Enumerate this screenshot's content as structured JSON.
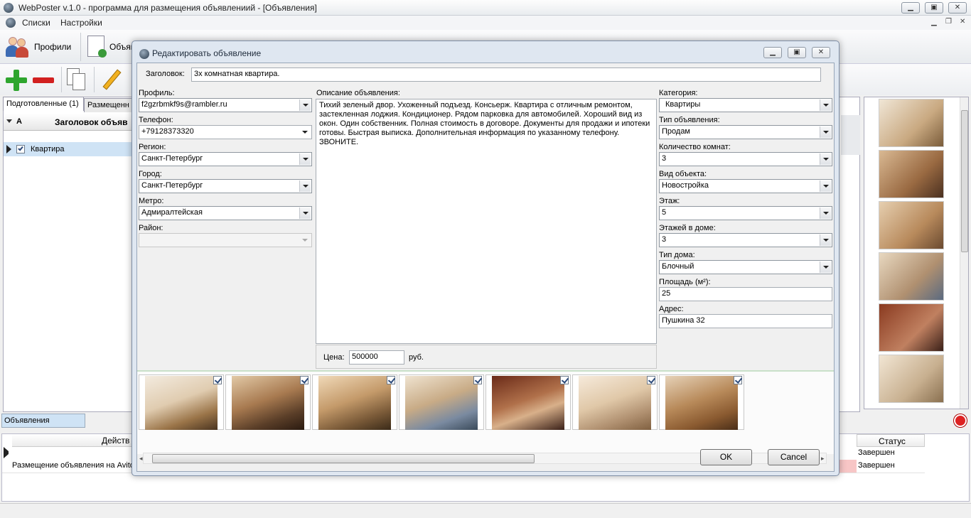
{
  "app": {
    "title": "WebPoster v.1.0 - программа для размещения объявлениий  - [Объявления]",
    "menu": [
      "Списки",
      "Настройки"
    ],
    "toolbar": {
      "profiles": "Профили",
      "ads": "Объявл"
    }
  },
  "main": {
    "tabs": [
      "Подготовленные (1)",
      "Размещенн"
    ],
    "grid_headers": {
      "a": "A",
      "title": "Заголовок объяв"
    },
    "row": {
      "title": "Квартира"
    },
    "bottom_tab": "Объявления",
    "log_headers": {
      "action": "Действ",
      "status": "Статус"
    },
    "log_rows": [
      {
        "action": "",
        "status": "Завершен"
      },
      {
        "action": "Размещение объявления на Avito",
        "status": "Завершен"
      }
    ]
  },
  "dialog": {
    "title": "Редактировать объявление",
    "heading_label": "Заголовок:",
    "heading_value": "3х комнатная квартира.",
    "left": {
      "profile": {
        "label": "Профиль:",
        "value": "f2gzrbmkf9s@rambler.ru"
      },
      "phone": {
        "label": "Телефон:",
        "value": "+79128373320"
      },
      "region": {
        "label": "Регион:",
        "value": "Санкт-Петербург"
      },
      "city": {
        "label": "Город:",
        "value": "Санкт-Петербург"
      },
      "metro": {
        "label": "Метро:",
        "value": "Адмиралтейская"
      },
      "district": {
        "label": "Район:",
        "value": ""
      }
    },
    "description": {
      "label": "Описание объявления:",
      "text": "Тихий зеленый двор. Ухоженный подъезд. Консьерж. Квартира с отличным ремонтом, застекленная лоджия. Кондиционер. Рядом парковка для автомобилей. Хороший вид из окон. Один собственник. Полная стоимость в договоре. Документы для продажи и ипотеки готовы. Быстрая выписка. Дополнительная информация по указанному телефону. ЗВОНИТЕ."
    },
    "price": {
      "label": "Цена:",
      "value": "500000",
      "unit": "руб."
    },
    "right": {
      "category": {
        "label": "Категория:",
        "value": "Квартиры"
      },
      "ad_type": {
        "label": "Тип объявления:",
        "value": "Продам"
      },
      "rooms": {
        "label": "Количество комнат:",
        "value": "3"
      },
      "object_type": {
        "label": "Вид объекта:",
        "value": "Новостройка"
      },
      "floor": {
        "label": "Этаж:",
        "value": "5"
      },
      "floors_total": {
        "label": "Этажей в доме:",
        "value": "3"
      },
      "house_type": {
        "label": "Тип дома:",
        "value": "Блочный"
      },
      "area": {
        "label": "Площадь (м²):",
        "value": "25"
      },
      "address": {
        "label": "Адрес:",
        "value": "Пушкина 32"
      }
    },
    "buttons": {
      "ok": "OK",
      "cancel": "Cancel"
    }
  },
  "colors": {
    "selection": "#cfe3f5",
    "dialog_frame": "#dfe7f1",
    "add_green": "#2ea52e",
    "remove_red": "#d22020"
  }
}
